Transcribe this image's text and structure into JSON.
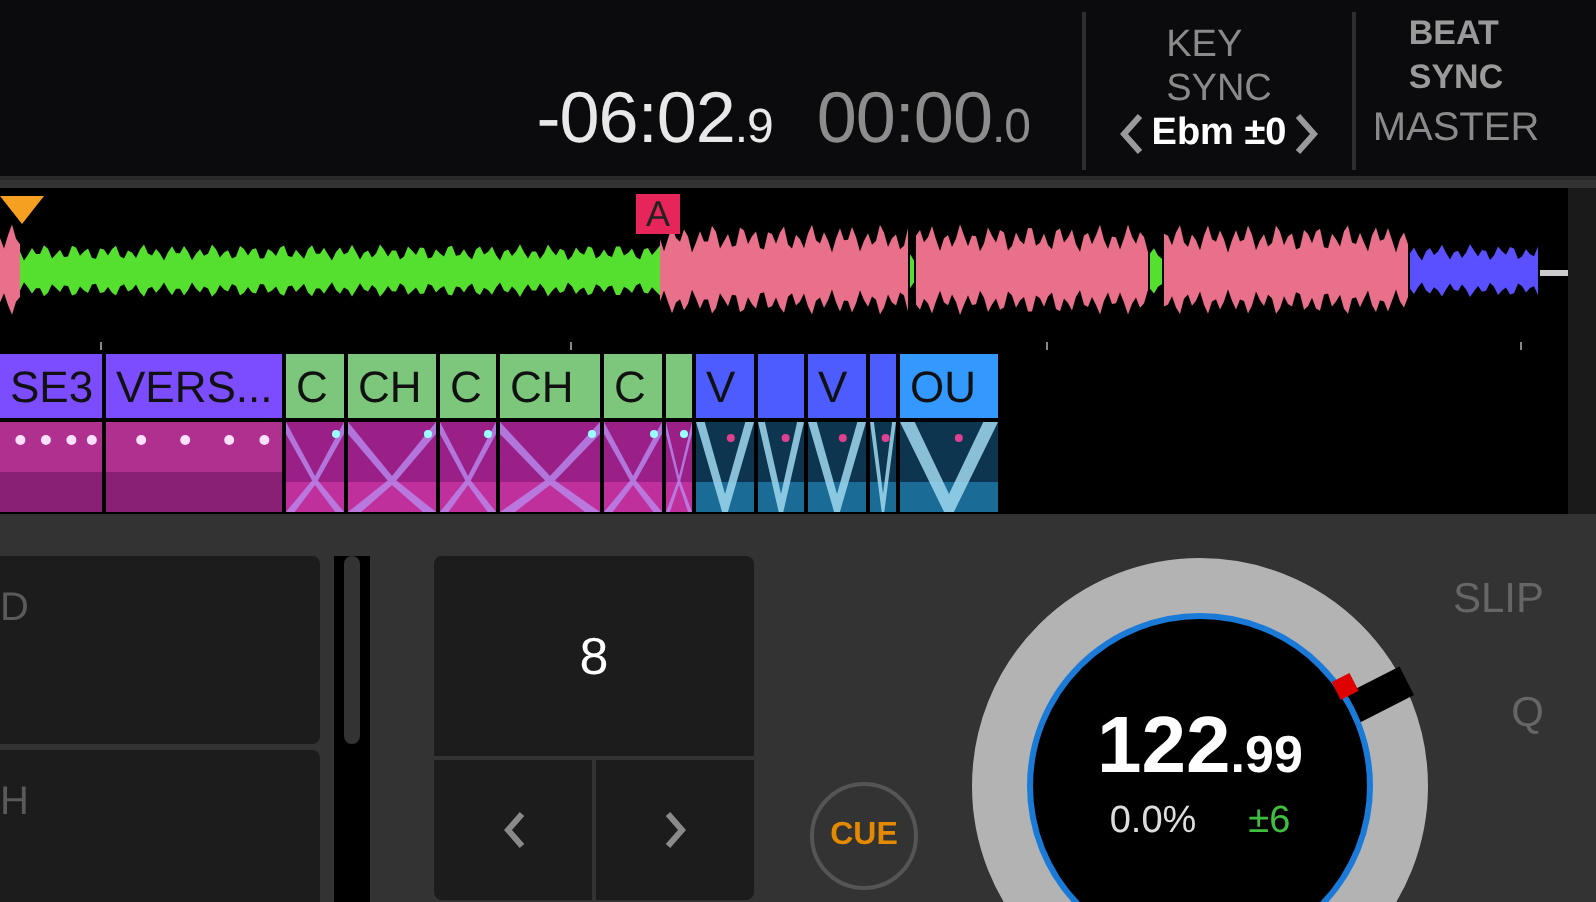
{
  "time": {
    "remaining": "-06:02",
    "remaining_tenths": ".9",
    "elapsed": "00:00",
    "elapsed_tenths": ".0"
  },
  "key_sync": {
    "line1": "KEY",
    "line2": "SYNC",
    "key": "Ebm ±0"
  },
  "beat_sync": {
    "line1": "BEAT",
    "line2": "SYNC",
    "master": "MASTER"
  },
  "waveform": {
    "hot_cue": "A"
  },
  "phrases": [
    {
      "label": "SE3",
      "color": "#7b4dff"
    },
    {
      "label": "VERS...",
      "color": "#7b4dff"
    },
    {
      "label": "C",
      "color": "#7dc77d"
    },
    {
      "label": "CH",
      "color": "#7dc77d"
    },
    {
      "label": "C",
      "color": "#7dc77d"
    },
    {
      "label": "CH",
      "color": "#7dc77d"
    },
    {
      "label": "C",
      "color": "#7dc77d"
    },
    {
      "color": "#7dc77d"
    },
    {
      "label": "V",
      "color": "#4c5cff"
    },
    {
      "color": "#4c5cff"
    },
    {
      "label": "V",
      "color": "#4c5cff"
    },
    {
      "color": "#4c5cff"
    },
    {
      "label": "OU",
      "color": "#3399ff"
    }
  ],
  "pads": [
    {
      "label": "D"
    },
    {
      "label": "H"
    }
  ],
  "beat_loop": {
    "value": "8"
  },
  "cue_button": "CUE",
  "jog": {
    "bpm": "122",
    "bpm_fraction": ".99",
    "tempo": "0.0%",
    "tempo_range": "±6"
  },
  "side_buttons": [
    "SLIP",
    "Q"
  ]
}
